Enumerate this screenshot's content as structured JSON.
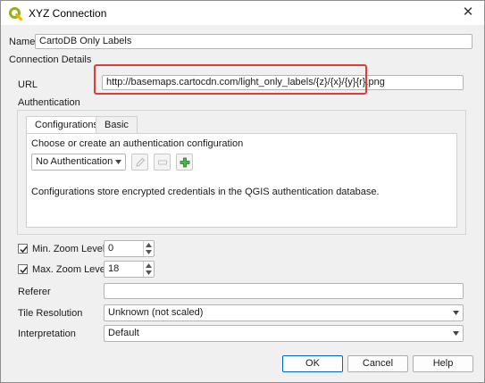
{
  "window": {
    "title": "XYZ Connection",
    "close_glyph": "✕",
    "app_icon": "qgis-icon"
  },
  "name": {
    "label": "Name",
    "value": "CartoDB Only Labels"
  },
  "section": {
    "label": "Connection Details"
  },
  "url": {
    "label": "URL",
    "value": "http://basemaps.cartocdn.com/light_only_labels/{z}/{x}/{y}{r}.png"
  },
  "authentication": {
    "label": "Authentication",
    "tabs": [
      {
        "label": "Configurations"
      },
      {
        "label": "Basic"
      }
    ],
    "choose_label": "Choose or create an authentication configuration",
    "selected": "No Authentication",
    "info": "Configurations store encrypted credentials in the QGIS authentication database."
  },
  "min_zoom": {
    "label": "Min. Zoom Level",
    "value": "0",
    "checked": true
  },
  "max_zoom": {
    "label": "Max. Zoom Level",
    "value": "18",
    "checked": true
  },
  "referer": {
    "label": "Referer",
    "value": ""
  },
  "tile_resolution": {
    "label": "Tile Resolution",
    "value": "Unknown (not scaled)"
  },
  "interpretation": {
    "label": "Interpretation",
    "value": "Default"
  },
  "buttons": {
    "ok": "OK",
    "cancel": "Cancel",
    "help": "Help"
  },
  "colors": {
    "highlight": "#e03a3a",
    "default_button": "#0067c0",
    "add_icon": "#2e9b2e"
  }
}
